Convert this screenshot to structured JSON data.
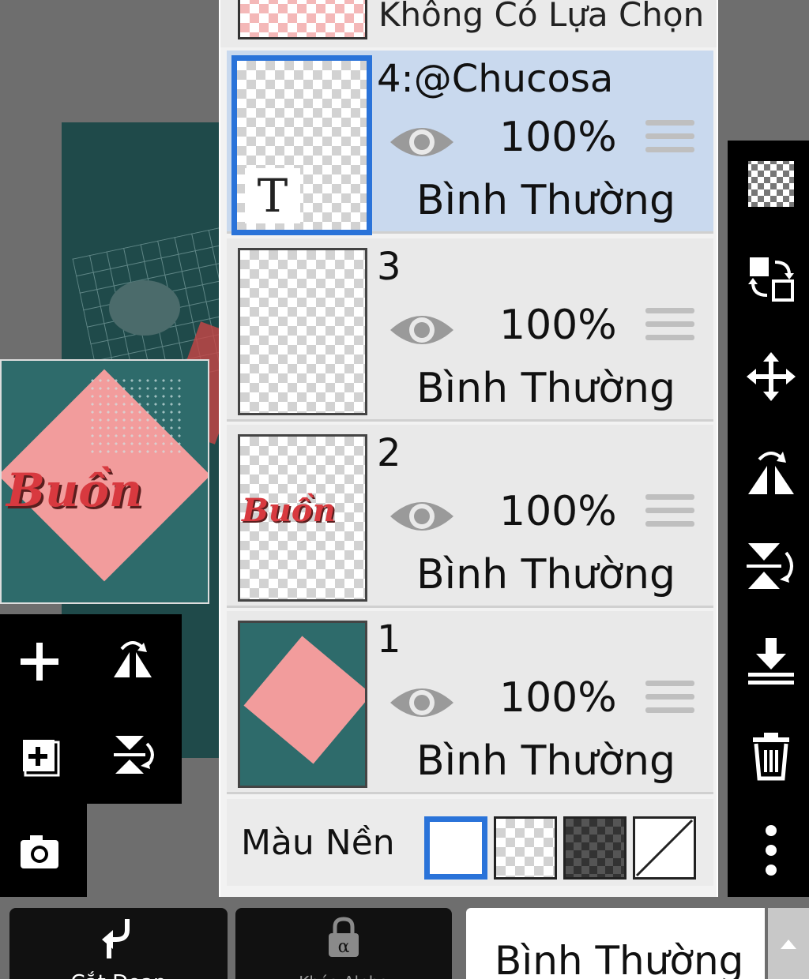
{
  "panel": {
    "no_selection_label": "Không Có Lựa Chọn",
    "layers": [
      {
        "name": "4:@Chucosa",
        "opacity": "100%",
        "blend": "Bình Thường",
        "selected": true
      },
      {
        "name": "3",
        "opacity": "100%",
        "blend": "Bình Thường",
        "selected": false
      },
      {
        "name": "2",
        "opacity": "100%",
        "blend": "Bình Thường",
        "selected": false
      },
      {
        "name": "1",
        "opacity": "100%",
        "blend": "Bình Thường",
        "selected": false
      }
    ],
    "background_label": "Màu Nền"
  },
  "thumbnails": {
    "text_layer_mark": "T",
    "artwork_word": "Buồn"
  },
  "bottom": {
    "clip_label": "Cắt Đoạn",
    "alpha_lock_label": "Khóa Alpha",
    "blend_mode_value": "Bình Thường"
  },
  "colors": {
    "selected_row": "#c9d9ee",
    "accent": "#2a73d9",
    "toolbar": "#000000"
  },
  "icons": {
    "left_tools": [
      "plus-icon",
      "flip-horizontal-icon",
      "add-layer-icon",
      "flip-vertical-icon",
      "camera-icon"
    ],
    "right_tools": [
      "transparency-icon",
      "swap-icon",
      "move-icon",
      "flip-horizontal-icon",
      "flip-vertical-icon",
      "merge-down-icon",
      "trash-icon",
      "more-icon"
    ]
  }
}
